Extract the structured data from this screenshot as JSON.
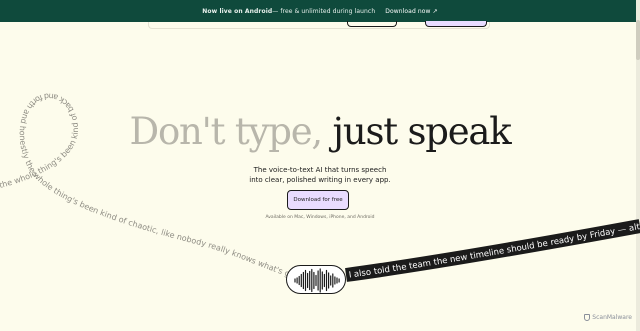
{
  "banner": {
    "bold": "Now live on Android",
    "text": " — free & unlimited during launch",
    "link": "Download now",
    "arrow": "↗"
  },
  "hero": {
    "title_light": "Don't type,",
    "title_dark": " just speak",
    "subtitle_line1": "The voice-to-text AI that turns speech",
    "subtitle_line2": "into clear, polished writing in every app.",
    "cta": "Download for free",
    "available": "Available on Mac, Windows, iPhone, and Android"
  },
  "curve_text": {
    "grey": "the whole thing's been kind of back and forth and honestly the whole thing's been kind of chaotic, like nobody really knows what's going on so can you check",
    "black": "I also told the team the new timeline should be ready by Friday — alt"
  },
  "watermark": {
    "text": "ScanMalware",
    "icon": "shield-icon"
  },
  "colors": {
    "background": "#fdfcec",
    "banner": "#0f4a3c",
    "cta": "#e9dcff",
    "ribbon": "#1b1b1b"
  }
}
